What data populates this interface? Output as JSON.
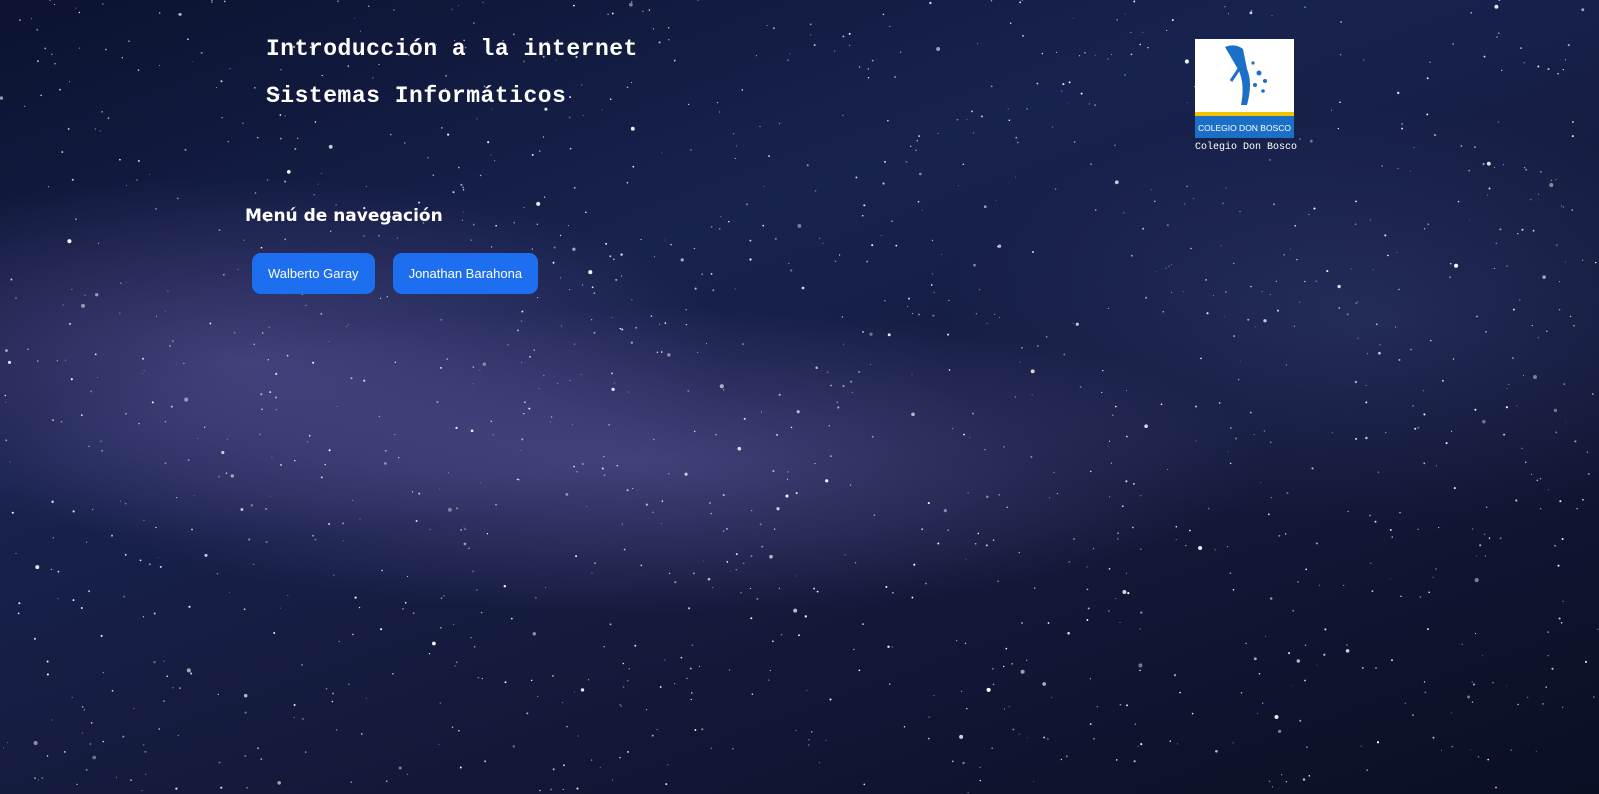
{
  "header": {
    "title": "Introducción a la internet",
    "subtitle": "Sistemas Informáticos"
  },
  "logo": {
    "icon": "school-logo-icon",
    "band_text": "COLEGIO DON BOSCO",
    "caption": "Colegio Don Bosco"
  },
  "nav": {
    "title": "Menú de navegación",
    "buttons": [
      {
        "label": "Walberto Garay"
      },
      {
        "label": "Jonathan Barahona"
      }
    ]
  },
  "colors": {
    "button": "#1e6ef0",
    "logo_blue": "#1c6fc7",
    "logo_yellow": "#f2c400",
    "text": "#ffffff"
  }
}
